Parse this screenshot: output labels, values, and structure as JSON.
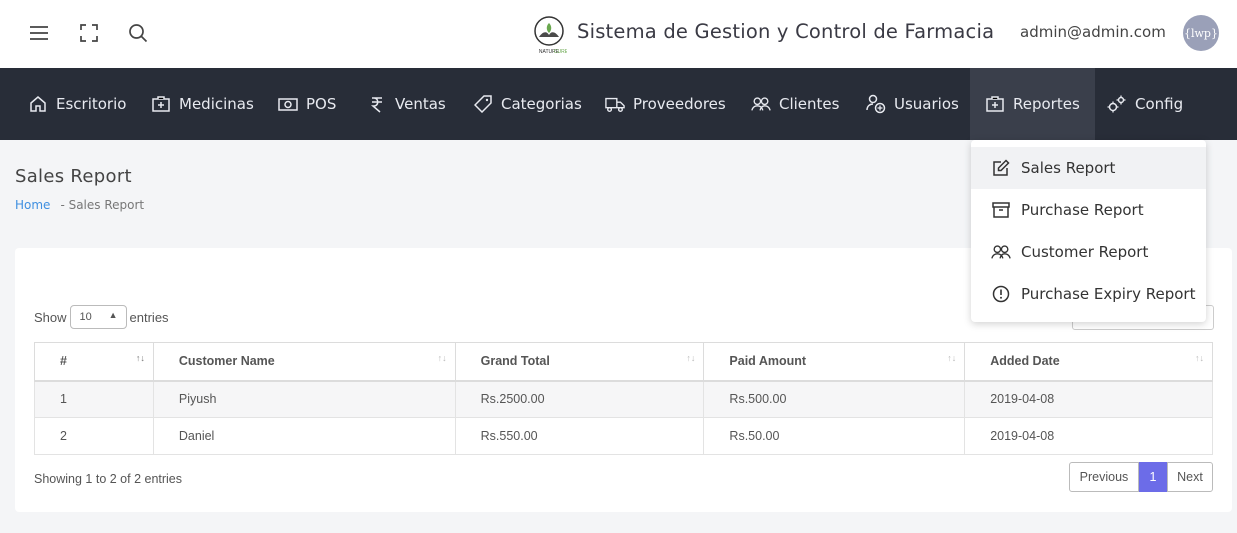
{
  "header": {
    "brand_title": "Sistema de Gestion y Control de Farmacia",
    "logo_text": "NATURECURE",
    "user_email": "admin@admin.com",
    "avatar_text": "{lwp}",
    "icons": [
      "menu-icon",
      "fullscreen-icon",
      "search-icon"
    ]
  },
  "nav": {
    "items": [
      {
        "label": "Escritorio",
        "icon": "home-icon"
      },
      {
        "label": "Medicinas",
        "icon": "medical-kit-icon"
      },
      {
        "label": "POS",
        "icon": "cash-icon"
      },
      {
        "label": "Ventas",
        "icon": "rupee-icon"
      },
      {
        "label": "Categorias",
        "icon": "tag-icon"
      },
      {
        "label": "Proveedores",
        "icon": "truck-icon"
      },
      {
        "label": "Clientes",
        "icon": "users-icon"
      },
      {
        "label": "Usuarios",
        "icon": "user-add-icon"
      },
      {
        "label": "Reportes",
        "icon": "report-kit-icon"
      },
      {
        "label": "Config",
        "icon": "gears-icon"
      }
    ],
    "active": "Reportes"
  },
  "dropdown": {
    "items": [
      {
        "label": "Sales Report",
        "icon": "edit-icon"
      },
      {
        "label": "Purchase Report",
        "icon": "archive-icon"
      },
      {
        "label": "Customer Report",
        "icon": "users-icon"
      },
      {
        "label": "Purchase Expiry Report",
        "icon": "alert-circle-icon"
      }
    ]
  },
  "page": {
    "title": "Sales Report",
    "breadcrumb_home": "Home",
    "breadcrumb_current": "- Sales Report"
  },
  "table": {
    "show_label": "Show",
    "entries_label": "entries",
    "page_length": "10",
    "columns": [
      "#",
      "Customer Name",
      "Grand Total",
      "Paid Amount",
      "Added Date"
    ],
    "rows": [
      [
        "1",
        "Piyush",
        "Rs.2500.00",
        "Rs.500.00",
        "2019-04-08"
      ],
      [
        "2",
        "Daniel",
        "Rs.550.00",
        "Rs.50.00",
        "2019-04-08"
      ]
    ],
    "info": "Showing 1 to 2 of 2 entries",
    "pager": {
      "previous": "Previous",
      "current": "1",
      "next": "Next"
    }
  },
  "colors": {
    "navbar": "#282d38",
    "accent": "#6c6ce8",
    "link": "#3f8fe0"
  }
}
